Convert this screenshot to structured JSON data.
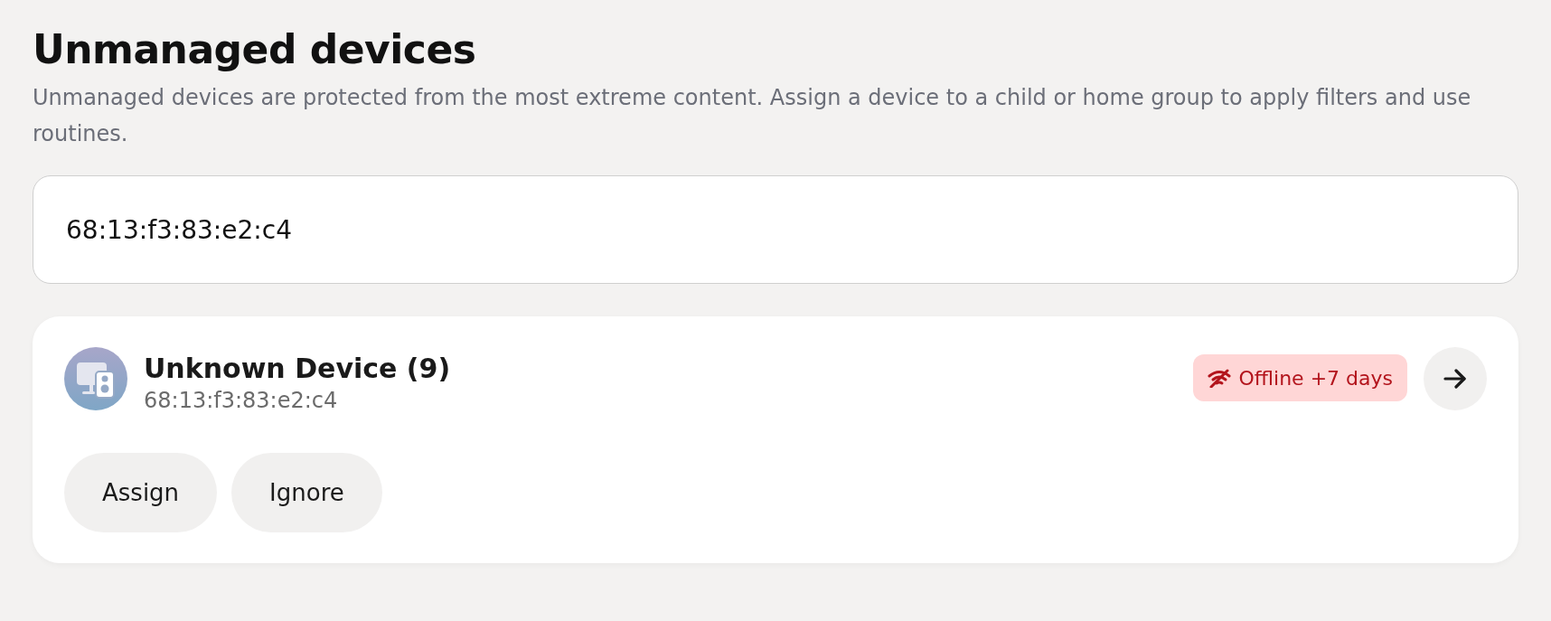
{
  "title": "Unmanaged devices",
  "description": "Unmanaged devices are protected from the most extreme content. Assign a device to a child or home group to apply filters and use routines.",
  "search": {
    "value": "68:13:f3:83:e2:c4"
  },
  "devices": [
    {
      "name": "Unknown Device (9)",
      "address": "68:13:f3:83:e2:c4",
      "status": "Offline +7 days",
      "actions": [
        "Assign",
        "Ignore"
      ]
    }
  ]
}
